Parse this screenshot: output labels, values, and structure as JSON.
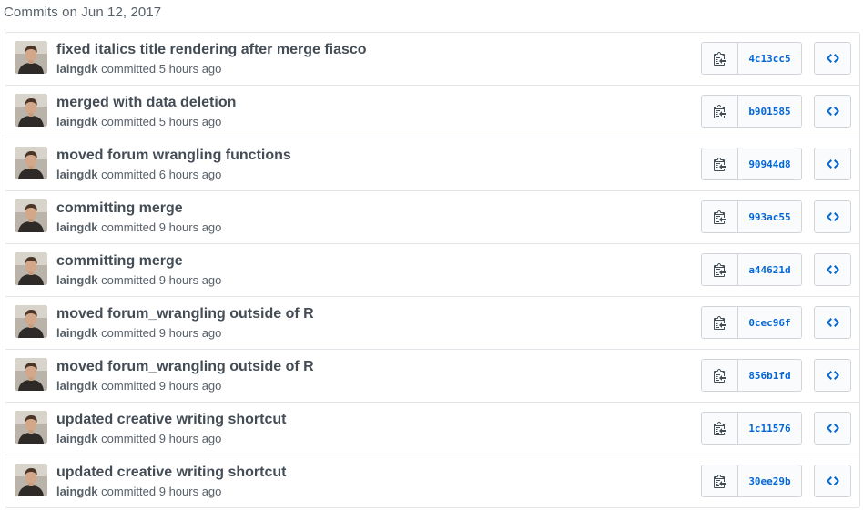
{
  "group_header": "Commits on Jun 12, 2017",
  "verb": "committed",
  "colors": {
    "sha": "#0366d6",
    "title": "#444d56",
    "meta": "#586069",
    "border": "#e1e4e8"
  },
  "icons": {
    "copy": "clippy-icon",
    "browse": "code-icon"
  },
  "commits": [
    {
      "title": "fixed italics title rendering after merge fiasco",
      "author": "laingdk",
      "time": "5 hours ago",
      "sha": "4c13cc5"
    },
    {
      "title": "merged with data deletion",
      "author": "laingdk",
      "time": "5 hours ago",
      "sha": "b901585"
    },
    {
      "title": "moved forum wrangling functions",
      "author": "laingdk",
      "time": "6 hours ago",
      "sha": "90944d8"
    },
    {
      "title": "committing merge",
      "author": "laingdk",
      "time": "9 hours ago",
      "sha": "993ac55"
    },
    {
      "title": "committing merge",
      "author": "laingdk",
      "time": "9 hours ago",
      "sha": "a44621d"
    },
    {
      "title": "moved forum_wrangling outside of R",
      "author": "laingdk",
      "time": "9 hours ago",
      "sha": "0cec96f"
    },
    {
      "title": "moved forum_wrangling outside of R",
      "author": "laingdk",
      "time": "9 hours ago",
      "sha": "856b1fd"
    },
    {
      "title": "updated creative writing shortcut",
      "author": "laingdk",
      "time": "9 hours ago",
      "sha": "1c11576"
    },
    {
      "title": "updated creative writing shortcut",
      "author": "laingdk",
      "time": "9 hours ago",
      "sha": "30ee29b"
    }
  ]
}
